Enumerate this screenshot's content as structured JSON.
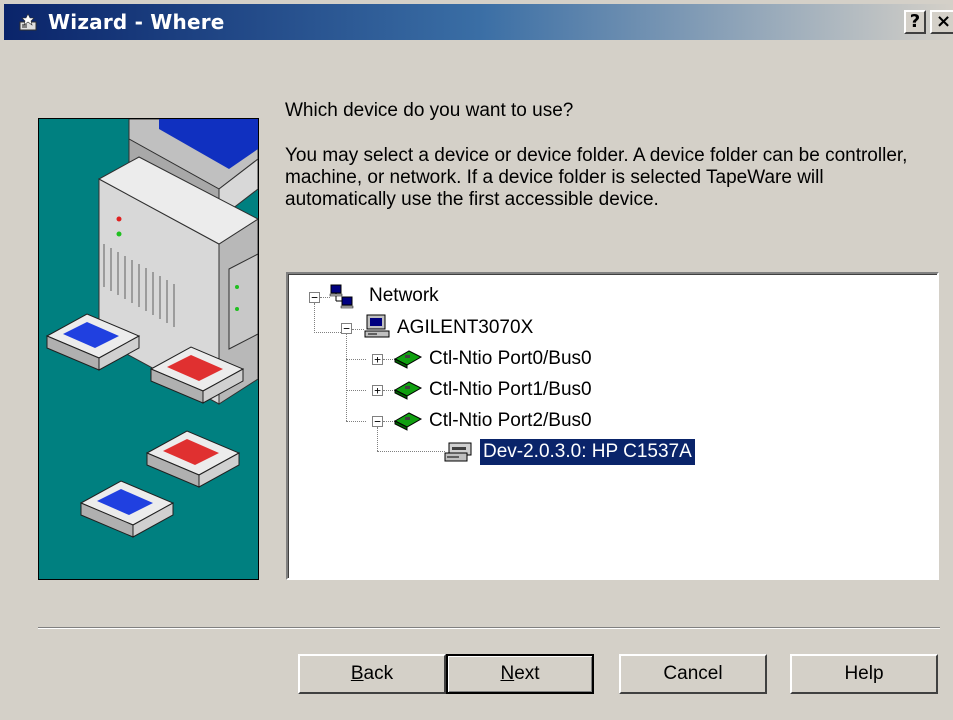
{
  "window": {
    "title": "Wizard - Where",
    "help_button": "?",
    "close_button": "×"
  },
  "content": {
    "question": "Which device do you want to use?",
    "description": "You may select a device or device folder.  A device folder can be controller, machine, or network.   If a device folder is selected TapeWare will automatically use the first accessible device."
  },
  "tree": {
    "nodes": [
      {
        "label": "Network",
        "expander": "−",
        "icon": "network-icon"
      },
      {
        "label": "AGILENT3070X",
        "expander": "−",
        "icon": "computer-icon"
      },
      {
        "label": "Ctl-Ntio Port0/Bus0",
        "expander": "+",
        "icon": "controller-card-icon"
      },
      {
        "label": "Ctl-Ntio Port1/Bus0",
        "expander": "+",
        "icon": "controller-card-icon"
      },
      {
        "label": "Ctl-Ntio Port2/Bus0",
        "expander": "−",
        "icon": "controller-card-icon"
      },
      {
        "label": "Dev-2.0.3.0: HP C1537A",
        "expander": "",
        "icon": "tape-drive-icon",
        "selected": true
      }
    ]
  },
  "buttons": {
    "back": {
      "pre": "",
      "accel": "B",
      "post": "ack"
    },
    "next": {
      "pre": "",
      "accel": "N",
      "post": "ext"
    },
    "cancel": "Cancel",
    "help": "Help"
  },
  "colors": {
    "title_gradient_start": "#0a246a",
    "selection": "#0a246a",
    "art_background": "#008080",
    "dialog_face": "#d4d0c8"
  }
}
